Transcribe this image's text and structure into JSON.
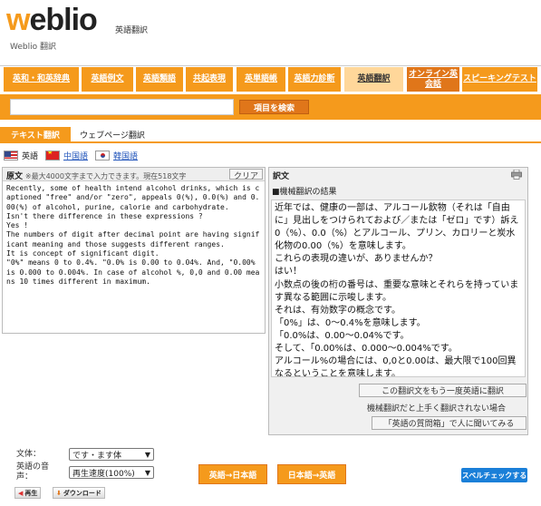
{
  "header": {
    "logo": "weblio",
    "logo_sub": "英語翻訳",
    "caption": "Weblio 翻訳"
  },
  "nav": {
    "items": [
      {
        "label": "英和・和英辞典"
      },
      {
        "label": "英語例文"
      },
      {
        "label": "英語類語"
      },
      {
        "label": "共起表現"
      },
      {
        "label": "英単語帳"
      },
      {
        "label": "英語力診断"
      },
      {
        "label": "英語翻訳"
      },
      {
        "label": "オンライン英会話"
      },
      {
        "label": "スピーキングテスト"
      }
    ]
  },
  "search": {
    "value": "",
    "button": "項目を検索"
  },
  "tabs": {
    "text": "テキスト翻訳",
    "web": "ウェブページ翻訳"
  },
  "languages": {
    "english": "英語",
    "chinese": "中国語",
    "korean": "韓国語"
  },
  "source": {
    "title": "原文",
    "note": "※最大4000文字まで入力できます。現在518文字",
    "count": "518",
    "clear": "クリア",
    "text": "Recently, some of health intend alcohol drinks, which is captioned \"free\" and/or \"zero\", appeals 0(%), 0.0(%) and 0.00(%) of alcohol, purine, calorie and carbohydrate.\nIsn't there difference in these expressions ?\nYes !\nThe numbers of digit after decimal point are having significant meaning and those suggests different ranges.\nIt is concept of significant digit.\n\"0%\" means 0 to 0.4%. \"0.0% is 0.00 to 0.04%. And, \"0.00% is 0.000 to 0.004%. In case of alcohol %, 0,0 and 0.00 means 10 times different in maximum."
  },
  "result": {
    "title": "訳文",
    "subtitle": "■機械翻訳の結果",
    "text": "近年では、健康の一部は、アルコール飲物（それは「自由に」見出しをつけられておよび／または「ゼロ」です）訴え0（%）、0.0（%）とアルコール、プリン、カロリーと炭水化物の0.00（%）を意味します。\nこれらの表現の違いが、ありませんか？\nはい！\n小数点の後の桁の番号は、重要な意味とそれらを持っています異なる範囲に示唆します。\nそれは、有効数字の概念です。\n「0%」は、0～0.4%を意味します。\n「0.0%は、0.00～0.04%です。\nそして、「0.00%は、0.000～0.004%です。\nアルコール%の場合には、0,0と0.00は、最大限で100回異なるということを意味します。",
    "retranslate": "この翻訳文をもう一度英語に翻訳",
    "fail_note": "機械翻訳だと上手く翻訳されない場合",
    "ask": "「英語の質問箱」で人に聞いてみる"
  },
  "form": {
    "style_label": "文体：",
    "style_value": "です・ます体",
    "voice_label": "英語の音声：",
    "speed_value": "再生速度(100%)",
    "play": "再生",
    "download": "ダウンロード",
    "en_to_ja": "英語→日本語",
    "ja_to_en": "日本語→英語",
    "spellcheck": "スペルチェックする"
  },
  "colors": {
    "accent": "#f59a1c",
    "accent_dark": "#e0761a",
    "link": "#2255bb",
    "spell": "#1a7fd8"
  }
}
